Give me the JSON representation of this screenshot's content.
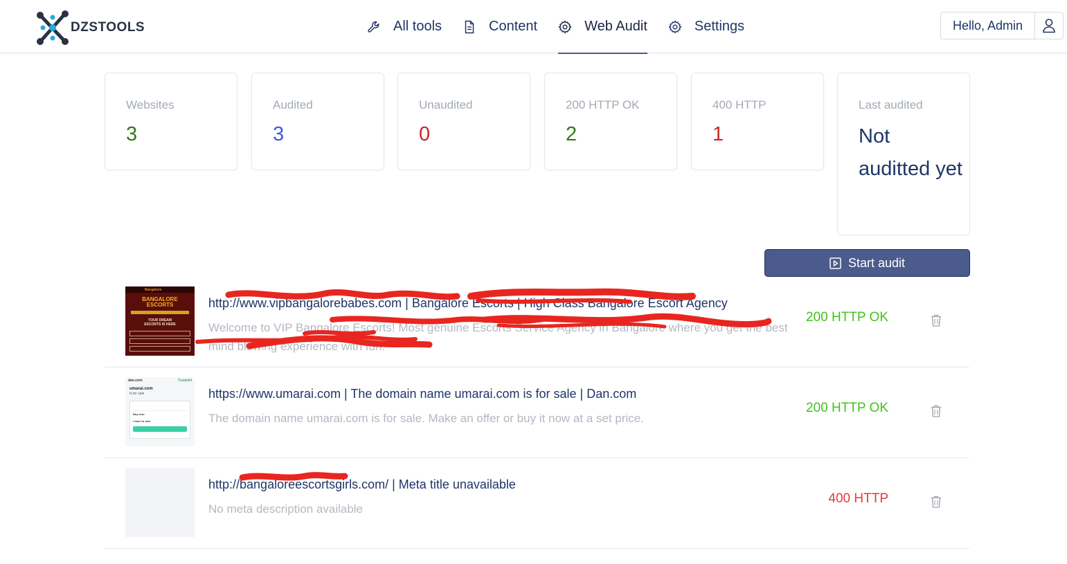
{
  "brand": {
    "name": "DZSTOOLS"
  },
  "nav": [
    {
      "label": "All tools",
      "icon": "wrench-icon"
    },
    {
      "label": "Content",
      "icon": "document-icon"
    },
    {
      "label": "Web Audit",
      "icon": "gear-icon",
      "active": true
    },
    {
      "label": "Settings",
      "icon": "gear-icon"
    }
  ],
  "user": {
    "greeting": "Hello, Admin",
    "icon": "user-icon"
  },
  "stats": [
    {
      "label": "Websites",
      "value": "3",
      "color": "#2e7d14"
    },
    {
      "label": "Audited",
      "value": "3",
      "color": "#3b5bdb"
    },
    {
      "label": "Unaudited",
      "value": "0",
      "color": "#c62828"
    },
    {
      "label": "200 HTTP OK",
      "value": "2",
      "color": "#2e7d14"
    },
    {
      "label": "400 HTTP",
      "value": "1",
      "color": "#c62828"
    },
    {
      "label": "Last audited",
      "value": "Not auditted yet",
      "color": "#1f3566"
    }
  ],
  "actions": {
    "start_audit": "Start audit"
  },
  "sites": [
    {
      "title": "http://www.vipbangalorebabes.com | Bangalore Escorts | High Class Bangalore Escort Agency",
      "description": "Welcome to VIP Bangalore Escorts! Most genuine Escorts Service Agency in Bangalore where you get the best mind blowing experience with fun.",
      "status": "200 HTTP OK",
      "status_color": "#43c11d",
      "thumb": "escort-site-screenshot",
      "redacted": true,
      "thumb_text": [
        "Bangalore",
        "BANGALORE",
        "ESCORTS",
        "YOUR DREAM",
        "ESCORTS IS HERE"
      ]
    },
    {
      "title": "https://www.umarai.com | The domain name umarai.com is for sale | Dan.com",
      "description": "The domain name umarai.com is for sale. Make an offer or buy it now at a set price.",
      "status": "200 HTTP OK",
      "status_color": "#43c11d",
      "thumb": "dan-com-screenshot",
      "redacted": false,
      "thumb_text": [
        "dan.com",
        "Trustpilot",
        "umarai.com",
        "is for sale",
        "Buy now",
        "Lease to own"
      ]
    },
    {
      "title": "http://bangaloreescortsgirls.com/ | Meta title unavailable",
      "description": "No meta description available",
      "status": "400 HTTP",
      "status_color": "#e53935",
      "thumb": "empty-placeholder",
      "redacted": true
    }
  ]
}
